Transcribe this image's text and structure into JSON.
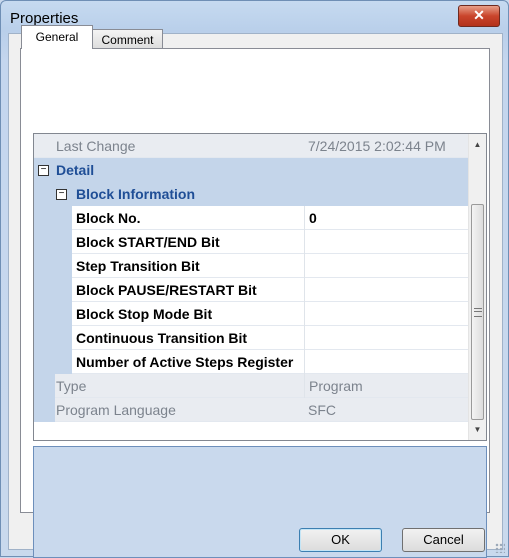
{
  "window": {
    "title": "Properties",
    "close_label": "✕"
  },
  "tabs": [
    {
      "label": "General"
    },
    {
      "label": "Comment"
    }
  ],
  "grid": {
    "last_change": {
      "name": "Last Change",
      "value": "7/24/2015 2:02:44 PM"
    },
    "detail_category": {
      "label": "Detail",
      "expander": "⊟"
    },
    "block_info": {
      "label": "Block Information",
      "expander": "⊟"
    },
    "properties": [
      {
        "name": "Block No.",
        "value": "0"
      },
      {
        "name": "Block START/END Bit",
        "value": ""
      },
      {
        "name": "Step Transition Bit",
        "value": ""
      },
      {
        "name": "Block PAUSE/RESTART Bit",
        "value": ""
      },
      {
        "name": "Block Stop Mode Bit",
        "value": ""
      },
      {
        "name": "Continuous Transition Bit",
        "value": ""
      },
      {
        "name": "Number of Active Steps Register",
        "value": ""
      }
    ],
    "type": {
      "name": "Type",
      "value": "Program"
    },
    "language": {
      "name": "Program Language",
      "value": "SFC"
    }
  },
  "buttons": {
    "ok": "OK",
    "cancel": "Cancel"
  }
}
